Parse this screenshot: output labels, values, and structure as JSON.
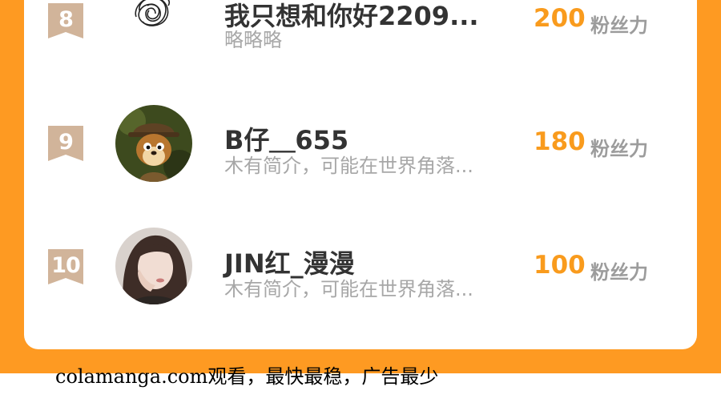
{
  "colors": {
    "accent": "#fe9a22",
    "score": "#f99b1d",
    "badge": "#d1b49a"
  },
  "ranking": [
    {
      "rank": "8",
      "name": "我只想和你好2209...",
      "description": "略略略",
      "score": "200",
      "unit": "粉丝力",
      "avatar_icon": "scribble-avatar"
    },
    {
      "rank": "9",
      "name": "B仔＿655",
      "description": "木有简介，可能在世界角落...",
      "score": "180",
      "unit": "粉丝力",
      "avatar_icon": "chipmunk-avatar"
    },
    {
      "rank": "10",
      "name": "JIN红_漫漫",
      "description": "木有简介，可能在世界角落...",
      "score": "100",
      "unit": "粉丝力",
      "avatar_icon": "girl-photo-avatar"
    }
  ],
  "footer": {
    "caption": "colamanga.com观看，最快最稳，广告最少"
  }
}
